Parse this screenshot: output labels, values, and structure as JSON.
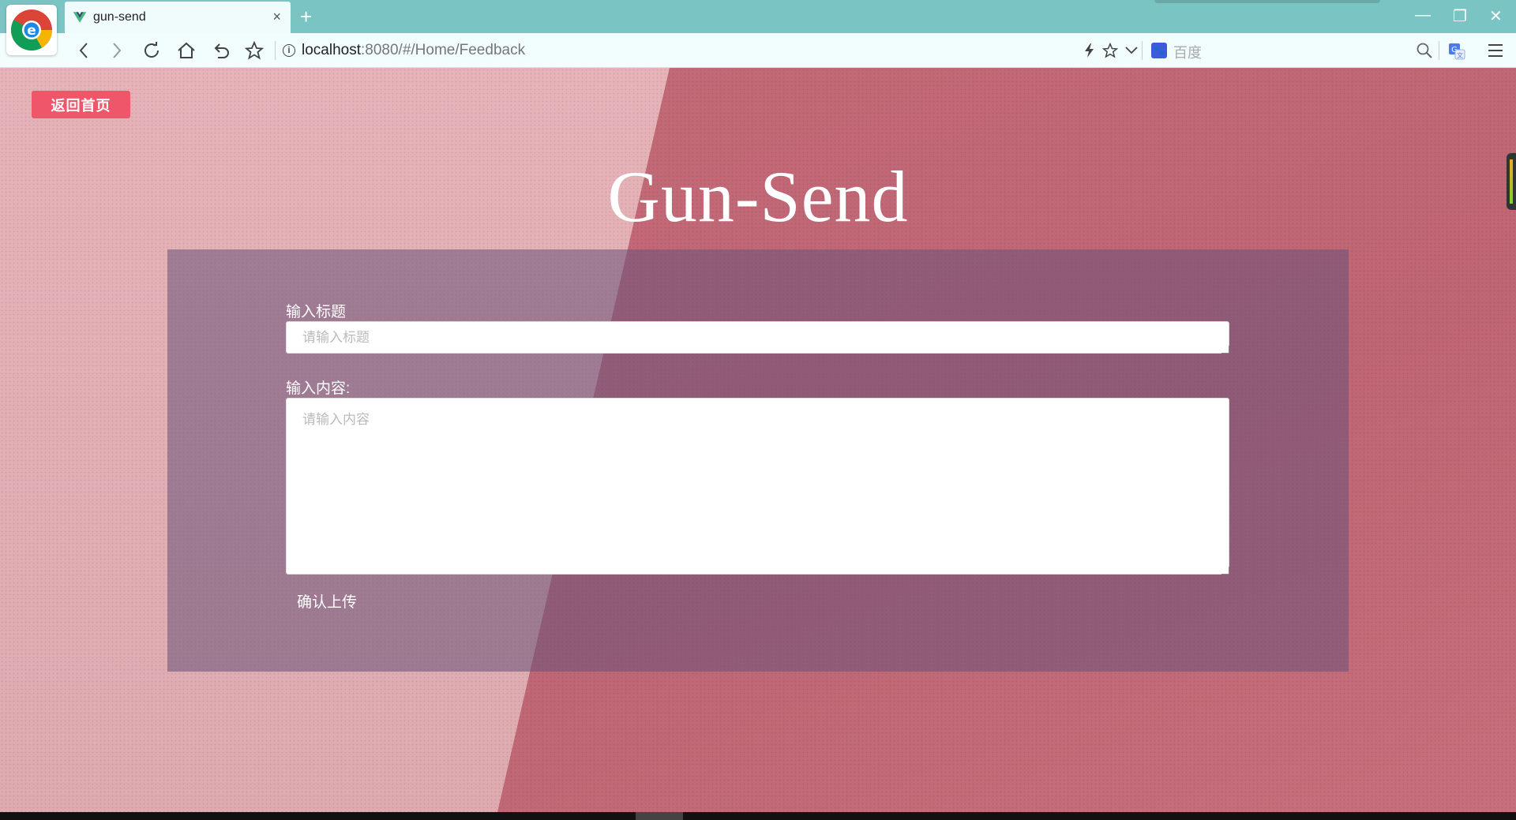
{
  "browser": {
    "tab_title": "gun-send",
    "tab_close": "×",
    "new_tab": "+",
    "url_host": "localhost",
    "url_rest": ":8080/#/Home/Feedback",
    "search_placeholder": "百度",
    "window_controls": {
      "minimize": "—",
      "restore": "❐",
      "close": "✕"
    },
    "icons": [
      "back-icon",
      "forward-icon",
      "reload-icon",
      "home-icon",
      "undo-icon",
      "star-icon",
      "lightning-icon",
      "search-icon",
      "translate-icon",
      "menu-icon"
    ]
  },
  "page": {
    "home_button": "返回首页",
    "logo_title": "Gun-Send",
    "form": {
      "title_label": "输入标题",
      "title_placeholder": "请输入标题",
      "content_label": "输入内容:",
      "content_placeholder": "请输入内容",
      "submit_label": "确认上传"
    }
  },
  "colors": {
    "accent_button": "#f0566a",
    "panel": "rgba(105, 82, 120, 0.55)",
    "chrome": "#7bc4c4"
  }
}
